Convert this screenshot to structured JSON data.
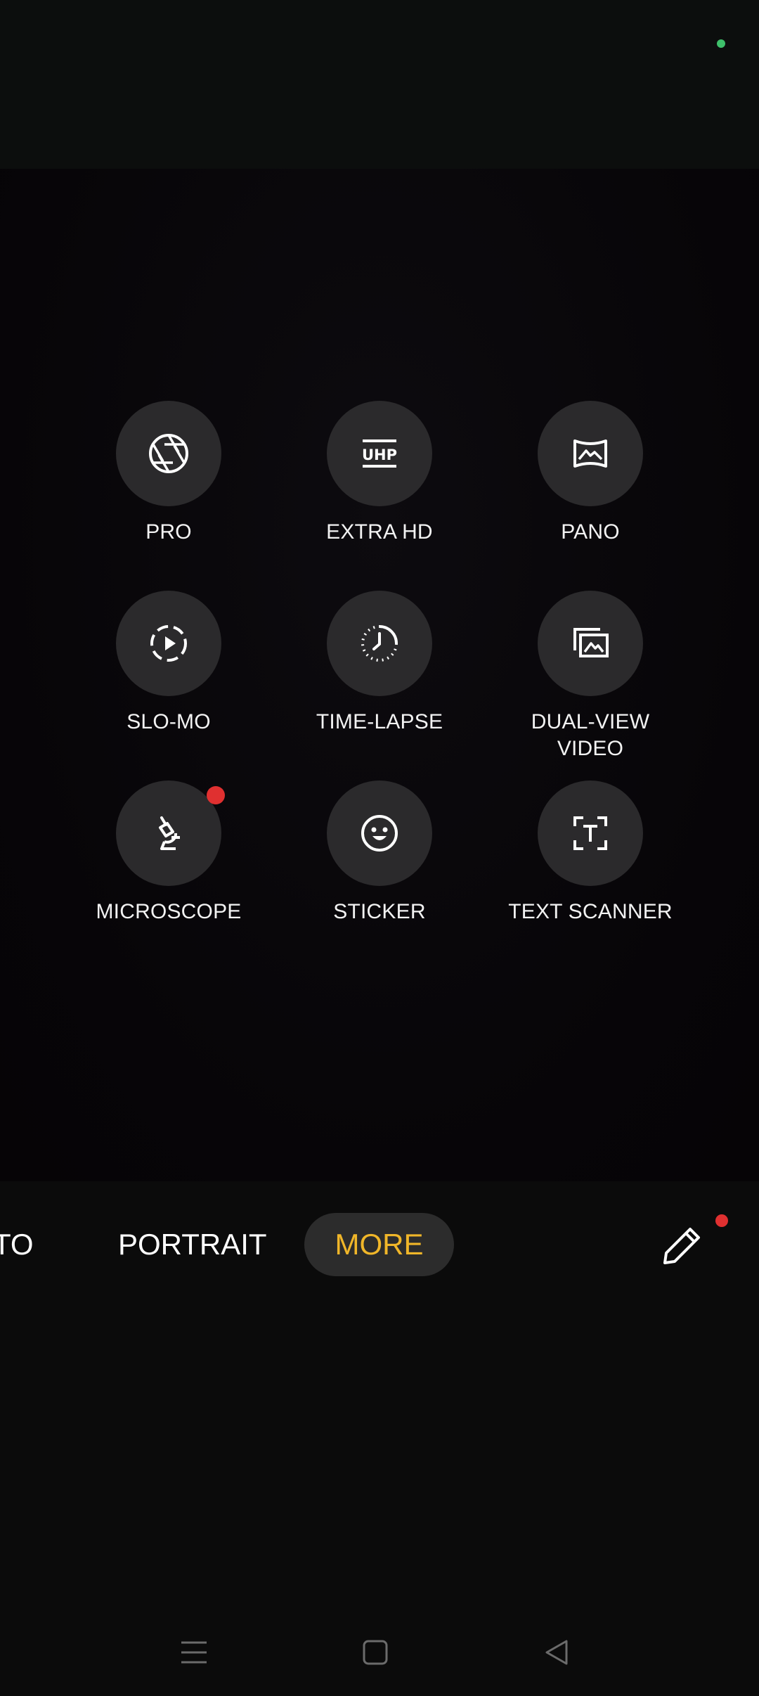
{
  "status": {
    "indicator_color": "#3ec06a"
  },
  "modes": [
    {
      "label": "PRO",
      "icon": "aperture-icon",
      "badge": false
    },
    {
      "label": "EXTRA HD",
      "icon": "uhp-icon",
      "badge": false
    },
    {
      "label": "PANO",
      "icon": "panorama-icon",
      "badge": false
    },
    {
      "label": "SLO-MO",
      "icon": "slow-motion-icon",
      "badge": false
    },
    {
      "label": "TIME-LAPSE",
      "icon": "time-lapse-icon",
      "badge": false
    },
    {
      "label": "DUAL-VIEW VIDEO",
      "icon": "dual-view-icon",
      "badge": false
    },
    {
      "label": "MICROSCOPE",
      "icon": "microscope-icon",
      "badge": true
    },
    {
      "label": "STICKER",
      "icon": "sticker-smiley-icon",
      "badge": false
    },
    {
      "label": "TEXT SCANNER",
      "icon": "text-scanner-icon",
      "badge": false
    }
  ],
  "mode_strip": {
    "partial_left": "TO",
    "portrait": "PORTRAIT",
    "more": "MORE",
    "active_color": "#f0b629",
    "edit_icon": "pencil-icon",
    "edit_badge_color": "#e03030"
  },
  "nav": {
    "menu_icon": "menu-icon",
    "home_icon": "home-square-icon",
    "back_icon": "back-triangle-icon"
  },
  "uhp_text": "UHP"
}
